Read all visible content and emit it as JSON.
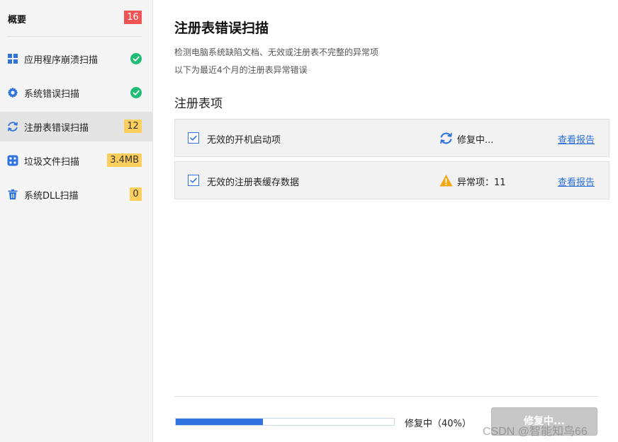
{
  "sidebar": {
    "overview": {
      "label": "概要",
      "count": "16"
    },
    "items": [
      {
        "label": "应用程序崩溃扫描",
        "icon": "grid-apps-icon",
        "status": "done"
      },
      {
        "label": "系统错误扫描",
        "icon": "gear-icon",
        "status": "done"
      },
      {
        "label": "注册表错误扫描",
        "icon": "refresh-icon",
        "badge": "12",
        "active": true
      },
      {
        "label": "垃圾文件扫描",
        "icon": "junk-files-icon",
        "badge": "3.4MB"
      },
      {
        "label": "系统DLL扫描",
        "icon": "trash-icon",
        "badge": "0"
      }
    ]
  },
  "main": {
    "title": "注册表错误扫描",
    "desc1": "检测电脑系统缺陷文档、无效或注册表不完整的异常项",
    "desc2": "以下为最近4个月的注册表异常错误",
    "section_title": "注册表项",
    "rows": [
      {
        "name": "无效的开机启动项",
        "status_icon": "refresh-icon",
        "status": "修复中...",
        "link": "查看报告"
      },
      {
        "name": "无效的注册表缓存数据",
        "status_icon": "warning-icon",
        "status": "异常项：11",
        "link": "查看报告"
      }
    ]
  },
  "footer": {
    "progress_percent": 40,
    "progress_text": "修复中（40%）",
    "button_label": "修复中..."
  },
  "watermark": "CSDN @智能知鸟66",
  "colors": {
    "accent": "#2f73df",
    "link": "#2b6fd6",
    "badge_red": "#f05454",
    "badge_yellow": "#ffcf5e",
    "success": "#1ebc72",
    "warning": "#f3a712"
  }
}
